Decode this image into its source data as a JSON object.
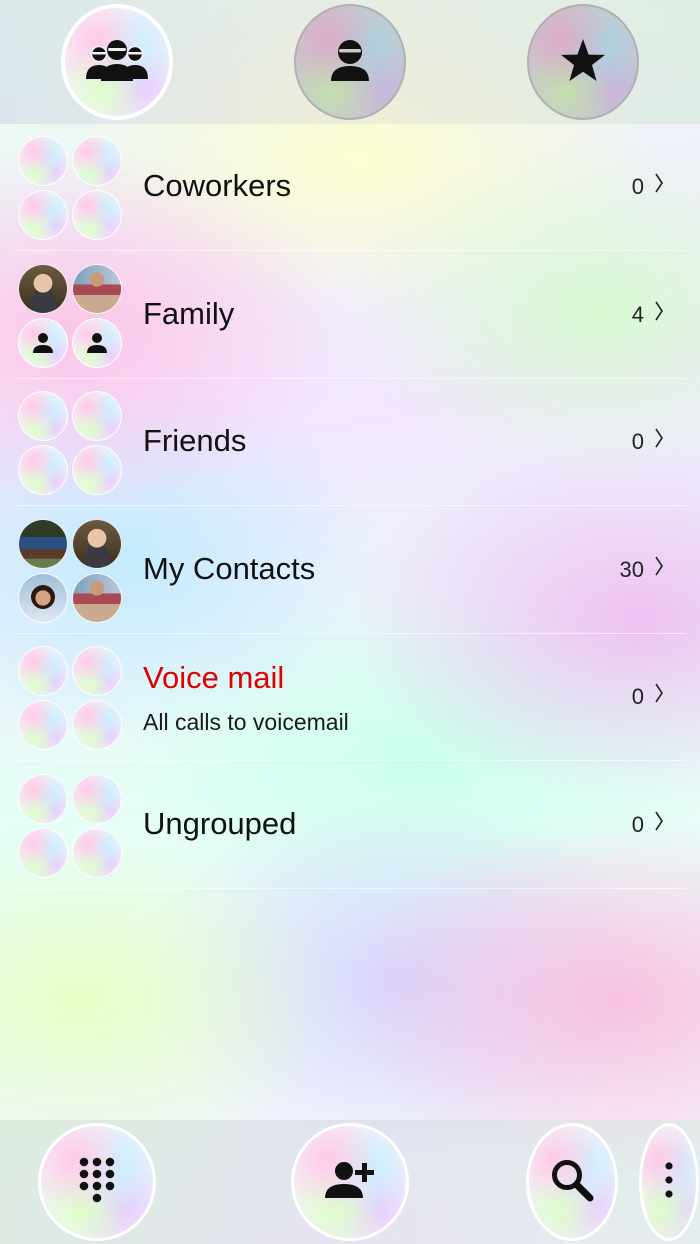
{
  "top_tabs": [
    {
      "name": "groups",
      "icon": "groups-icon",
      "active": true
    },
    {
      "name": "contacts",
      "icon": "person-icon",
      "active": false
    },
    {
      "name": "favorites",
      "icon": "star-icon",
      "active": false
    }
  ],
  "groups": [
    {
      "label": "Coworkers",
      "count": "0",
      "avatars": [
        "holo",
        "holo",
        "holo",
        "holo"
      ]
    },
    {
      "label": "Family",
      "count": "4",
      "avatars": [
        "photo-man",
        "photo-woman",
        "person-icon",
        "person-icon"
      ]
    },
    {
      "label": "Friends",
      "count": "0",
      "avatars": [
        "holo",
        "holo",
        "holo",
        "holo"
      ]
    },
    {
      "label": "My Contacts",
      "count": "30",
      "avatars": [
        "photo-group",
        "photo-man",
        "photo-girl",
        "photo-woman"
      ]
    },
    {
      "label": "Voice mail",
      "subtitle": "All calls to voicemail",
      "count": "0",
      "avatars": [
        "holo",
        "holo",
        "holo",
        "holo"
      ]
    },
    {
      "label": "Ungrouped",
      "count": "0",
      "avatars": [
        "holo",
        "holo",
        "holo",
        "holo"
      ]
    }
  ],
  "bottom_bar": [
    {
      "name": "dialpad",
      "icon": "dialpad-icon"
    },
    {
      "name": "add-contact",
      "icon": "add-person-icon"
    },
    {
      "name": "search",
      "icon": "search-icon"
    },
    {
      "name": "more",
      "icon": "more-vert-icon"
    }
  ],
  "colors": {
    "accent_red": "#e00000",
    "text": "#111111"
  }
}
